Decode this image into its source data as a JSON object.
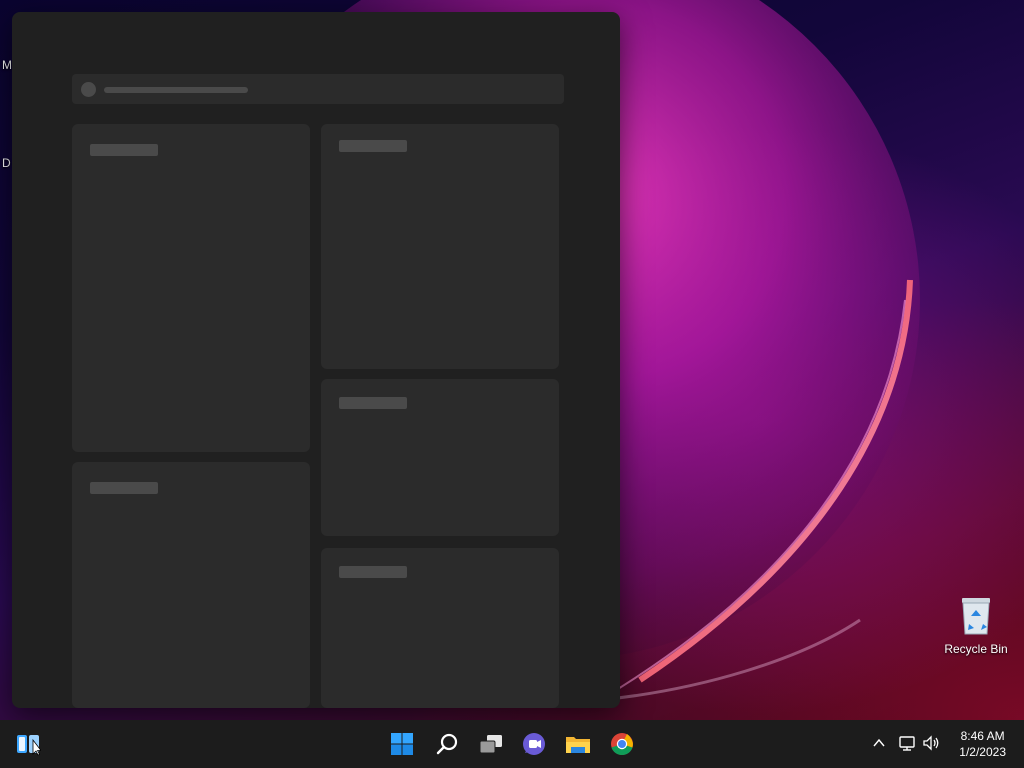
{
  "desktop": {
    "edge_letters": [
      "M",
      "D"
    ],
    "icons": [
      {
        "label": "Recycle Bin",
        "icon": "recycle-bin-icon"
      }
    ]
  },
  "widgets_panel": {
    "search_icon": "circle-placeholder",
    "cards": [
      "placeholder-card",
      "placeholder-card",
      "placeholder-card",
      "placeholder-card",
      "placeholder-card"
    ]
  },
  "taskbar": {
    "left": [
      {
        "icon": "widgets-icon"
      }
    ],
    "center": [
      {
        "icon": "start-windows-icon"
      },
      {
        "icon": "search-icon"
      },
      {
        "icon": "task-view-icon"
      },
      {
        "icon": "teams-chat-icon"
      },
      {
        "icon": "file-explorer-icon"
      },
      {
        "icon": "chrome-icon"
      }
    ],
    "tray": {
      "icons": [
        "chevron-up-icon",
        "network-icon",
        "volume-icon"
      ],
      "time": "8:46 AM",
      "date": "1/2/2023"
    }
  },
  "colors": {
    "panel": "#202020",
    "card": "#2b2b2b",
    "placeholder": "#4a4a4a",
    "taskbar": "#1c1c1c",
    "accent": "#0a84ff"
  }
}
